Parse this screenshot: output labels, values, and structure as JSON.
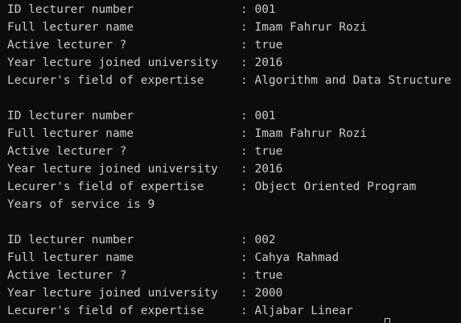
{
  "terminal": {
    "colors": {
      "background": "#0c0c0c",
      "foreground": "#cccccc"
    },
    "blocks": [
      {
        "id_label": "ID lecturer number",
        "id_value": ": 001",
        "name_label": "Full lecturer name",
        "name_value": ": Imam Fahrur Rozi",
        "active_label": "Active lecturer ?",
        "active_value": ": true",
        "year_label": "Year lecture joined university",
        "year_value": ": 2016",
        "field_label": "Lecurer's field of expertise",
        "field_value": ": Algorithm and Data Structure"
      },
      {
        "id_label": "ID lecturer number",
        "id_value": ": 001",
        "name_label": "Full lecturer name",
        "name_value": ": Imam Fahrur Rozi",
        "active_label": "Active lecturer ?",
        "active_value": ": true",
        "year_label": "Year lecture joined university",
        "year_value": ": 2016",
        "field_label": "Lecurer's field of expertise",
        "field_value": ": Object Oriented Program",
        "service_text": "Years of service is 9"
      },
      {
        "id_label": "ID lecturer number",
        "id_value": ": 002",
        "name_label": "Full lecturer name",
        "name_value": ": Cahya Rahmad",
        "active_label": "Active lecturer ?",
        "active_value": ": true",
        "year_label": "Year lecture joined university",
        "year_value": ": 2000",
        "field_label": "Lecurer's field of expertise",
        "field_value": ": Aljabar Linear"
      }
    ]
  }
}
